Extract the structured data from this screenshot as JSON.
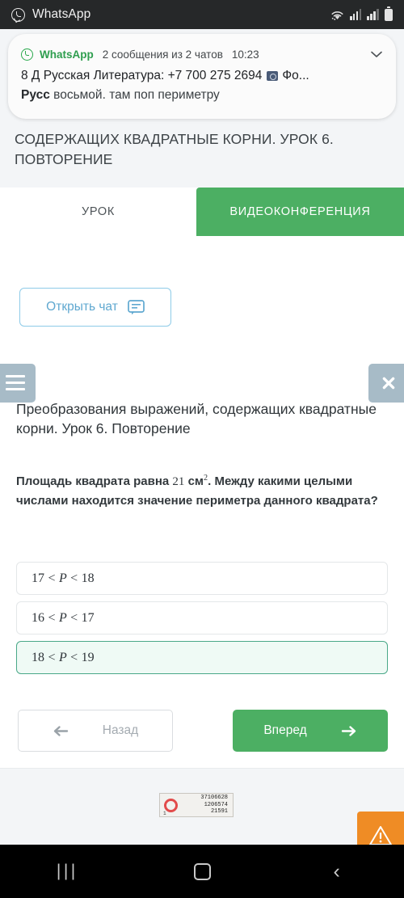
{
  "status_bar": {
    "app_name": "WhatsApp",
    "icons": [
      "whatsapp-icon",
      "wifi-icon",
      "signal-icon",
      "signal-icon",
      "battery-icon"
    ]
  },
  "notification": {
    "app_label": "WhatsApp",
    "summary": "2 сообщения из 2 чатов",
    "time": "10:23",
    "expand_icon": "chevron-down-icon",
    "message_1_sender": "8 Д Русская Литература: +7 700 275 2694",
    "message_1_attachment_icon": "photo-icon",
    "message_1_preview": "Фо...",
    "message_2_sender": "Русс",
    "message_2_preview": "восьмой. там поп периметру"
  },
  "page_header": {
    "title": "СОДЕРЖАЩИХ КВАДРАТНЫЕ КОРНИ. УРОК 6. ПОВТОРЕНИЕ"
  },
  "tabs": [
    {
      "label": "УРОК",
      "active": false
    },
    {
      "label": "ВИДЕОКОНФЕРЕНЦИЯ",
      "active": true
    }
  ],
  "chat": {
    "open_chat_label": "Открыть чат",
    "chat_icon": "chat-bubble-icon"
  },
  "exercise": {
    "menu_icon": "hamburger-menu-icon",
    "close_icon": "close-icon",
    "lesson_title": "Преобразования выражений, содержащих квадратные корни. Урок 6. Повторение",
    "question_part1": "Площадь квадрата равна ",
    "question_value": "21",
    "question_unit": " см",
    "question_exponent": "2",
    "question_part2": ". Между какими целыми числами находится значение периметра данного квадрата?",
    "answers": [
      {
        "left": "17",
        "op1": "<",
        "var": "P",
        "op2": "<",
        "right": "18",
        "selected": false
      },
      {
        "left": "16",
        "op1": "<",
        "var": "P",
        "op2": "<",
        "right": "17",
        "selected": false
      },
      {
        "left": "18",
        "op1": "<",
        "var": "P",
        "op2": "<",
        "right": "19",
        "selected": true
      }
    ],
    "back_label": "Назад",
    "back_icon": "arrow-left-icon",
    "forward_label": "Вперед",
    "forward_icon": "arrow-right-icon"
  },
  "footer": {
    "counter_logo_icon": "liveinternet-ring-icon",
    "counter_line1": "37106628",
    "counter_line2": "1206574",
    "counter_line3": "21591",
    "counter_index": "1",
    "warning_icon": "warning-triangle-icon"
  },
  "nav_bar": {
    "recents_icon": "|||",
    "recents_name": "recents-button",
    "home_name": "home-button",
    "back_glyph": "‹",
    "back_name": "back-button"
  },
  "colors": {
    "brand_green": "#4caf63",
    "notification_green": "#2f9e4f",
    "chat_blue": "#5fa8d0",
    "selected_green": "#4aa888",
    "panel_gray": "#a7bbc7",
    "warning_orange": "#ef8c25",
    "header_band": "#f3f5f7"
  }
}
